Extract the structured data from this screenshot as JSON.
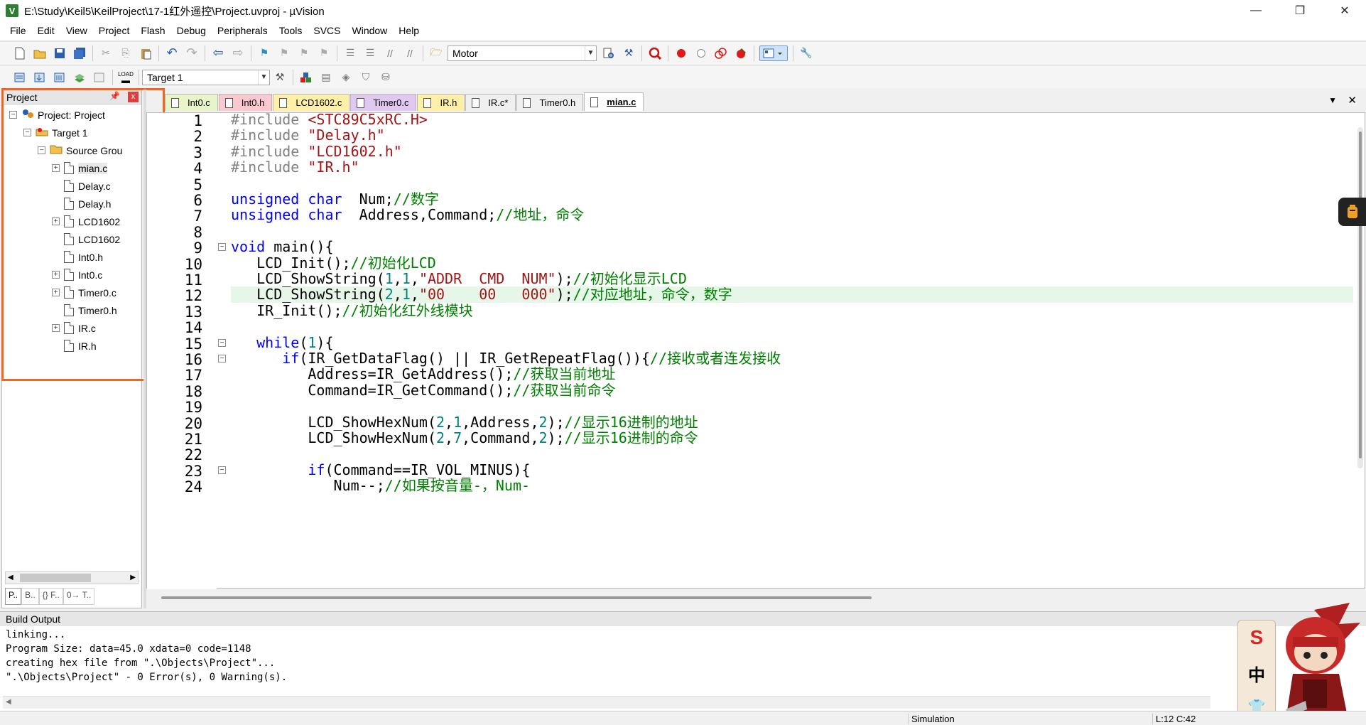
{
  "window": {
    "title": "E:\\Study\\Keil5\\KeilProject\\17-1红外遥控\\Project.uvproj - µVision",
    "icon": "V",
    "minimize": "—",
    "restore": "❐",
    "close": "✕"
  },
  "menu": [
    "File",
    "Edit",
    "View",
    "Project",
    "Flash",
    "Debug",
    "Peripherals",
    "Tools",
    "SVCS",
    "Window",
    "Help"
  ],
  "toolbar1": {
    "find_combo": "Motor"
  },
  "toolbar2": {
    "target_combo": "Target 1",
    "load_label": "LOAD"
  },
  "project_panel": {
    "title": "Project",
    "pin": "ᵖ",
    "close": "x",
    "tree": [
      {
        "label": "Project: Project",
        "level": 0,
        "exp": "−",
        "kind": "project"
      },
      {
        "label": "Target 1",
        "level": 1,
        "exp": "−",
        "kind": "target"
      },
      {
        "label": "Source Grou",
        "level": 2,
        "exp": "−",
        "kind": "folder"
      },
      {
        "label": "mian.c",
        "level": 3,
        "exp": "+",
        "kind": "file"
      },
      {
        "label": "Delay.c",
        "level": 3,
        "exp": "",
        "kind": "file"
      },
      {
        "label": "Delay.h",
        "level": 3,
        "exp": "",
        "kind": "file"
      },
      {
        "label": "LCD1602",
        "level": 3,
        "exp": "+",
        "kind": "file"
      },
      {
        "label": "LCD1602",
        "level": 3,
        "exp": "",
        "kind": "file"
      },
      {
        "label": "Int0.h",
        "level": 3,
        "exp": "",
        "kind": "file"
      },
      {
        "label": "Int0.c",
        "level": 3,
        "exp": "+",
        "kind": "file"
      },
      {
        "label": "Timer0.c",
        "level": 3,
        "exp": "+",
        "kind": "file"
      },
      {
        "label": "Timer0.h",
        "level": 3,
        "exp": "",
        "kind": "file"
      },
      {
        "label": "IR.c",
        "level": 3,
        "exp": "+",
        "kind": "file"
      },
      {
        "label": "IR.h",
        "level": 3,
        "exp": "",
        "kind": "file"
      }
    ],
    "bottom_tabs": [
      "P..",
      "B..",
      "{} F..",
      "0→ T.."
    ]
  },
  "tabs": [
    {
      "label": "Int0.c",
      "color": "#e8f5c8"
    },
    {
      "label": "Int0.h",
      "color": "#f9c8d0"
    },
    {
      "label": "LCD1602.c",
      "color": "#fff0a8"
    },
    {
      "label": "Timer0.c",
      "color": "#e0c8f0"
    },
    {
      "label": "IR.h",
      "color": "#fff0a8"
    },
    {
      "label": "IR.c*",
      "color": "#f0f0f0"
    },
    {
      "label": "Timer0.h",
      "color": "#f0f0f0"
    },
    {
      "label": "mian.c",
      "color": "#ffffff",
      "active": true
    }
  ],
  "tab_controls": {
    "dropdown": "▼",
    "close": "✕"
  },
  "editor": {
    "line_numbers": [
      "1",
      "2",
      "3",
      "4",
      "5",
      "6",
      "7",
      "8",
      "9",
      "10",
      "11",
      "12",
      "13",
      "14",
      "15",
      "16",
      "17",
      "18",
      "19",
      "20",
      "21",
      "22",
      "23",
      "24"
    ],
    "current_line": 12,
    "lines": [
      [
        [
          "pp",
          "#include "
        ],
        [
          "str",
          "<STC89C5xRC.H>"
        ]
      ],
      [
        [
          "pp",
          "#include "
        ],
        [
          "str",
          "\"Delay.h\""
        ]
      ],
      [
        [
          "pp",
          "#include "
        ],
        [
          "str",
          "\"LCD1602.h\""
        ]
      ],
      [
        [
          "pp",
          "#include "
        ],
        [
          "str",
          "\"IR.h\""
        ]
      ],
      [],
      [
        [
          "kw",
          "unsigned char"
        ],
        [
          "",
          "  Num;"
        ],
        [
          "cm",
          "//数字"
        ]
      ],
      [
        [
          "kw",
          "unsigned char"
        ],
        [
          "",
          "  Address,Command;"
        ],
        [
          "cm",
          "//地址，命令"
        ]
      ],
      [],
      [
        [
          "kw",
          "void"
        ],
        [
          "",
          " main(){"
        ]
      ],
      [
        [
          "",
          "   LCD_Init();"
        ],
        [
          "cm",
          "//初始化LCD"
        ]
      ],
      [
        [
          "",
          "   LCD_ShowString("
        ],
        [
          "num",
          "1"
        ],
        [
          "",
          ","
        ],
        [
          "num",
          "1"
        ],
        [
          "",
          ","
        ],
        [
          "str",
          "\"ADDR  CMD  NUM\""
        ],
        [
          "",
          ");"
        ],
        [
          "cm",
          "//初始化显示LCD"
        ]
      ],
      [
        [
          "",
          "   LCD_ShowString("
        ],
        [
          "num",
          "2"
        ],
        [
          "",
          ","
        ],
        [
          "num",
          "1"
        ],
        [
          "",
          ","
        ],
        [
          "str",
          "\"00    00   000\""
        ],
        [
          "",
          ");"
        ],
        [
          "cm",
          "//对应地址，命令，数字"
        ]
      ],
      [
        [
          "",
          "   IR_Init();"
        ],
        [
          "cm",
          "//初始化红外线模块"
        ]
      ],
      [],
      [
        [
          "kw",
          "   while"
        ],
        [
          "",
          "("
        ],
        [
          "num",
          "1"
        ],
        [
          "",
          "){"
        ]
      ],
      [
        [
          "kw",
          "      if"
        ],
        [
          "",
          "(IR_GetDataFlag() || IR_GetRepeatFlag()){"
        ],
        [
          "cm",
          "//接收或者连发接收"
        ]
      ],
      [
        [
          "",
          "         Address=IR_GetAddress();"
        ],
        [
          "cm",
          "//获取当前地址"
        ]
      ],
      [
        [
          "",
          "         Command=IR_GetCommand();"
        ],
        [
          "cm",
          "//获取当前命令"
        ]
      ],
      [],
      [
        [
          "",
          "         LCD_ShowHexNum("
        ],
        [
          "num",
          "2"
        ],
        [
          "",
          ","
        ],
        [
          "num",
          "1"
        ],
        [
          "",
          ",Address,"
        ],
        [
          "num",
          "2"
        ],
        [
          "",
          ");"
        ],
        [
          "cm",
          "//显示16进制的地址"
        ]
      ],
      [
        [
          "",
          "         LCD_ShowHexNum("
        ],
        [
          "num",
          "2"
        ],
        [
          "",
          ","
        ],
        [
          "num",
          "7"
        ],
        [
          "",
          ",Command,"
        ],
        [
          "num",
          "2"
        ],
        [
          "",
          ");"
        ],
        [
          "cm",
          "//显示16进制的命令"
        ]
      ],
      [],
      [
        [
          "kw",
          "         if"
        ],
        [
          "",
          "(Command==IR_VOL_MINUS){"
        ]
      ],
      [
        [
          "",
          "            Num--;"
        ],
        [
          "cm",
          "//如果按音量-，Num-"
        ]
      ]
    ]
  },
  "build_output": {
    "title": "Build Output",
    "lines": [
      "linking...",
      "Program Size: data=45.0 xdata=0 code=1148",
      "creating hex file from \".\\Objects\\Project\"...",
      "\".\\Objects\\Project\" - 0 Error(s), 0 Warning(s)."
    ]
  },
  "status": {
    "mode": "Simulation",
    "position": "L:12 C:42"
  },
  "overlay": {
    "badge_s": "S",
    "badge_zh": "中",
    "badge_shirt": "👕"
  }
}
